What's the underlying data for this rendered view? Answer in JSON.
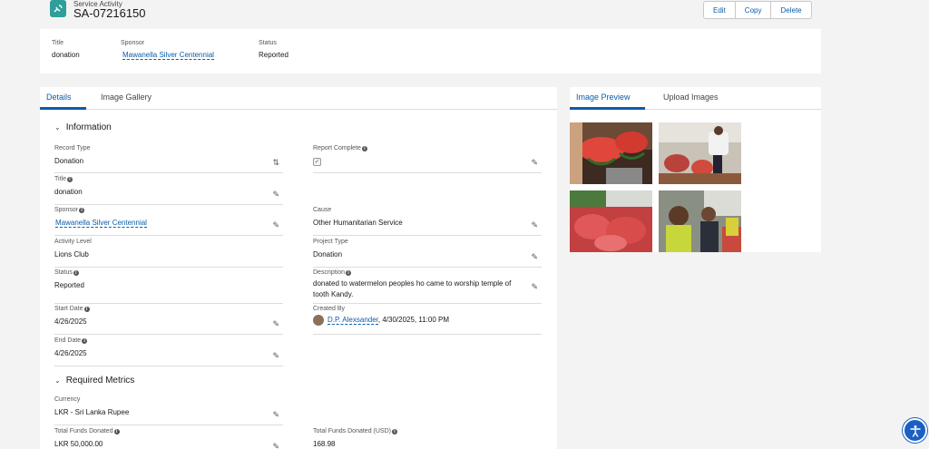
{
  "header": {
    "object_type": "Service Activity",
    "record_name": "SA-07216150",
    "actions": {
      "edit": "Edit",
      "copy": "Copy",
      "delete": "Delete"
    }
  },
  "highlights": {
    "title_label": "Title",
    "title_value": "donation",
    "sponsor_label": "Sponsor",
    "sponsor_value": "Mawanella Silver Centennial",
    "status_label": "Status",
    "status_value": "Reported"
  },
  "left_tabs": {
    "details": "Details",
    "gallery": "Image Gallery"
  },
  "right_tabs": {
    "preview": "Image Preview",
    "upload": "Upload Images"
  },
  "sections": {
    "information": "Information",
    "metrics": "Required Metrics"
  },
  "fields": {
    "record_type": {
      "label": "Record Type",
      "value": "Donation"
    },
    "report_complete": {
      "label": "Report Complete",
      "value": "✓"
    },
    "title": {
      "label": "Title",
      "value": "donation"
    },
    "sponsor": {
      "label": "Sponsor",
      "value": "Mawanella Silver Centennial"
    },
    "cause": {
      "label": "Cause",
      "value": "Other Humanitarian Service"
    },
    "activity_level": {
      "label": "Activity Level",
      "value": "Lions Club"
    },
    "project_type": {
      "label": "Project Type",
      "value": "Donation"
    },
    "status": {
      "label": "Status",
      "value": "Reported"
    },
    "description": {
      "label": "Description",
      "value": "donated to watermelon peoples ho came to worship temple of tooth Kandy."
    },
    "start_date": {
      "label": "Start Date",
      "value": "4/26/2025"
    },
    "created_by": {
      "label": "Created By",
      "user": "D.P. Alexsander",
      "timestamp": ", 4/30/2025, 11:00 PM"
    },
    "end_date": {
      "label": "End Date",
      "value": "4/26/2025"
    },
    "currency": {
      "label": "Currency",
      "value": "LKR - Sri Lanka Rupee"
    },
    "total_funds": {
      "label": "Total Funds Donated",
      "value": "LKR 50,000.00"
    },
    "total_funds_usd": {
      "label": "Total Funds Donated (USD)",
      "value": "168.98"
    }
  },
  "icons": {
    "app": "service-activity-icon",
    "edit": "pencil-icon",
    "change_type": "swap-icon",
    "info": "info-icon",
    "a11y": "accessibility-icon"
  },
  "colors": {
    "brand": "#0b5cab",
    "app_icon": "#2e9f9a",
    "a11y": "#1b5fc4"
  }
}
